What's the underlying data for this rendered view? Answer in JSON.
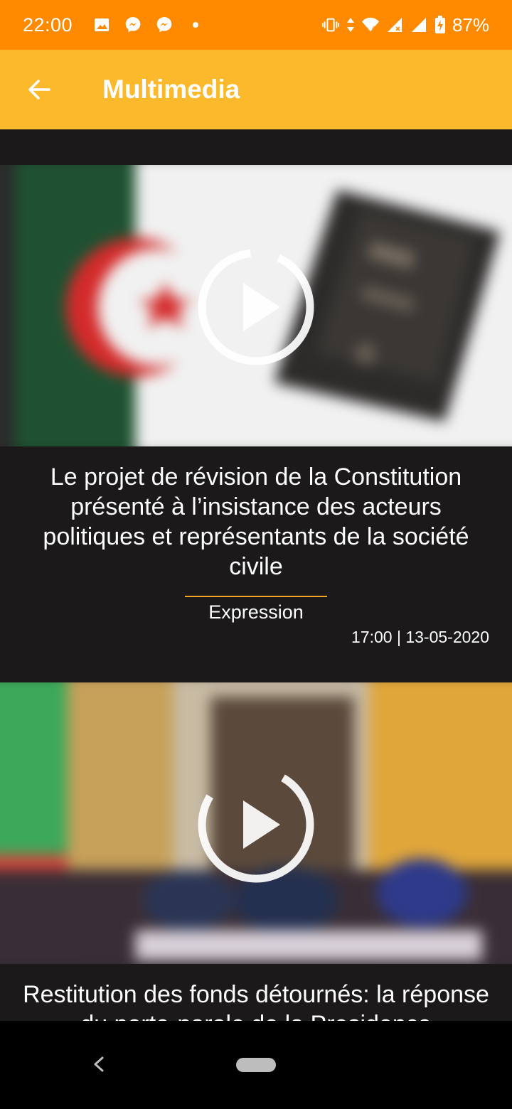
{
  "status_bar": {
    "time": "22:00",
    "battery": "87%",
    "left_icons": [
      "image-icon",
      "messenger-icon",
      "messenger-icon",
      "dot-icon"
    ],
    "right_icons": [
      "vibrate-icon",
      "data-arrows-icon",
      "wifi-icon",
      "signal-icon",
      "signal-icon",
      "battery-icon"
    ]
  },
  "app_bar": {
    "title": "Multimedia",
    "back_icon": "arrow-left-icon"
  },
  "articles": [
    {
      "title": "Le projet de révision de la Constitution présenté à l’insistance des acteurs politiques et représentants de la société civile",
      "source": "Expression",
      "date": "17:00 | 13-05-2020",
      "play_icon": "play-circle-icon"
    },
    {
      "title": "Restitution des fonds détournés: la réponse du porte-parole de la Presidence",
      "play_icon": "play-circle-icon"
    }
  ],
  "colors": {
    "status_bar": "#ff8a00",
    "app_bar": "#fdb92c",
    "background": "#1b191a",
    "accent_rule": "#f5a623"
  }
}
